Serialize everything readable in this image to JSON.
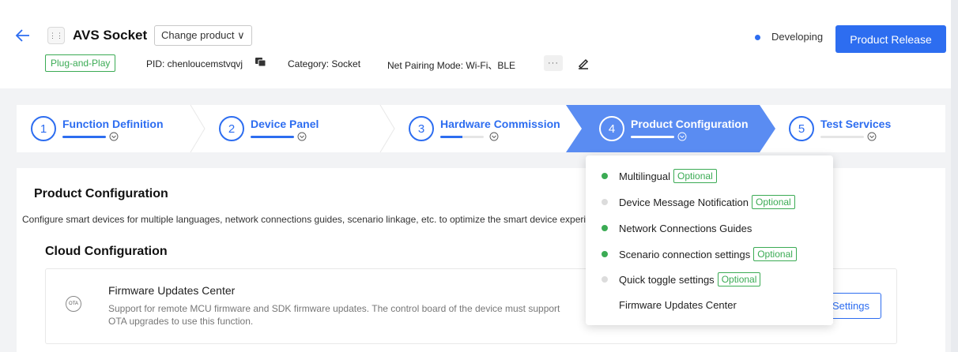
{
  "header": {
    "product_name": "AVS Socket",
    "change_product_label": "Change product ∨",
    "status": "Developing",
    "release_button": "Product Release",
    "plug_and_play": "Plug-and-Play",
    "pid": "PID: chenloucemstvqvj",
    "category": "Category: Socket",
    "net_pairing": "Net Pairing Mode: Wi-Fi、BLE",
    "more": "···",
    "accent_color": "#2d6df0"
  },
  "steps": [
    {
      "num": "1",
      "label": "Function Definition",
      "progress": 1.0
    },
    {
      "num": "2",
      "label": "Device Panel",
      "progress": 1.0
    },
    {
      "num": "3",
      "label": "Hardware Commission",
      "progress": 0.5
    },
    {
      "num": "4",
      "label": "Product Configuration",
      "progress": 1.0
    },
    {
      "num": "5",
      "label": "Test Services",
      "progress": 0.0
    }
  ],
  "main": {
    "title": "Product Configuration",
    "description": "Configure smart devices for multiple languages, network connections guides, scenario linkage, etc. to optimize the smart device experience.",
    "cloud_title": "Cloud Configuration",
    "card": {
      "icon_text": "OTA",
      "title": "Firmware Updates Center",
      "description": "Support for remote MCU firmware and SDK firmware updates. The control board of the device must support OTA upgrades to use this function.",
      "button": "Settings"
    }
  },
  "dropdown": {
    "items": [
      {
        "label": "Multilingual",
        "optional": "Optional",
        "status": "done"
      },
      {
        "label": "Device Message Notification",
        "optional": "Optional",
        "status": "todo"
      },
      {
        "label": "Network Connections Guides",
        "optional": "",
        "status": "done"
      },
      {
        "label": "Scenario connection settings",
        "optional": "Optional",
        "status": "done"
      },
      {
        "label": "Quick toggle settings",
        "optional": "Optional",
        "status": "todo"
      },
      {
        "label": "Firmware Updates Center",
        "optional": "",
        "status": "none"
      }
    ]
  }
}
